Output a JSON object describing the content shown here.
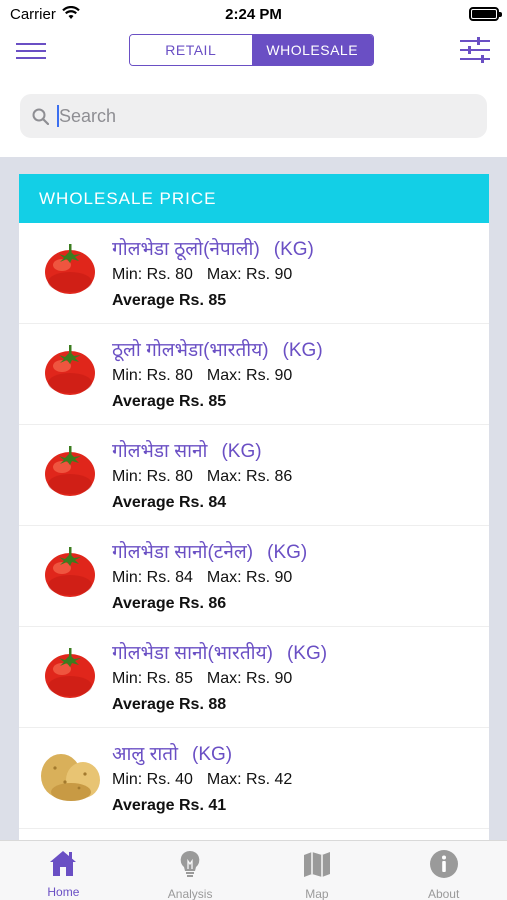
{
  "status_bar": {
    "carrier": "Carrier",
    "time": "2:24 PM"
  },
  "segment": {
    "retail": "RETAIL",
    "wholesale": "WHOLESALE",
    "selected": "wholesale"
  },
  "search": {
    "placeholder": "Search",
    "value": ""
  },
  "list": {
    "header": "WHOLESALE PRICE",
    "items": [
      {
        "name": "गोलभेडा ठूलो(नेपाली)",
        "unit": "(KG)",
        "min": "Min: Rs. 80",
        "max": "Max: Rs. 90",
        "avg": "Average Rs. 85",
        "icon": "tomato-icon"
      },
      {
        "name": "ठूलो गोलभेडा(भारतीय)",
        "unit": "(KG)",
        "min": "Min: Rs. 80",
        "max": "Max: Rs. 90",
        "avg": "Average Rs. 85",
        "icon": "tomato-icon"
      },
      {
        "name": "गोलभेडा सानो",
        "unit": "(KG)",
        "min": "Min: Rs. 80",
        "max": "Max: Rs. 86",
        "avg": "Average Rs. 84",
        "icon": "tomato-icon"
      },
      {
        "name": "गोलभेडा सानो(टनेल)",
        "unit": "(KG)",
        "min": "Min: Rs. 84",
        "max": "Max: Rs. 90",
        "avg": "Average Rs. 86",
        "icon": "tomato-icon"
      },
      {
        "name": "गोलभेडा सानो(भारतीय)",
        "unit": "(KG)",
        "min": "Min: Rs. 85",
        "max": "Max: Rs. 90",
        "avg": "Average Rs. 88",
        "icon": "tomato-icon"
      },
      {
        "name": "आलु रातो",
        "unit": "(KG)",
        "min": "Min: Rs. 40",
        "max": "Max: Rs. 42",
        "avg": "Average Rs. 41",
        "icon": "potato-icon"
      }
    ]
  },
  "tabs": [
    {
      "label": "Home",
      "icon": "home-icon",
      "active": true
    },
    {
      "label": "Analysis",
      "icon": "lightbulb-icon",
      "active": false
    },
    {
      "label": "Map",
      "icon": "map-icon",
      "active": false
    },
    {
      "label": "About",
      "icon": "info-icon",
      "active": false
    }
  ],
  "colors": {
    "accent": "#6a4fc4",
    "header": "#13cfe6",
    "background": "#dcdfe8",
    "inactive": "#9a9a9a"
  }
}
